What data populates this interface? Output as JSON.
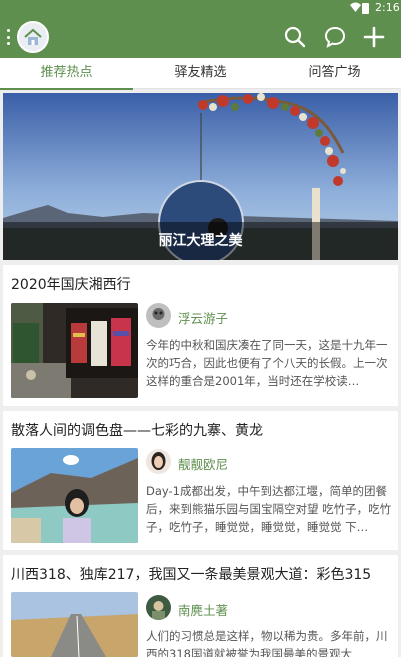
{
  "status_bar": {
    "time": "2:16"
  },
  "app": {
    "accent": "#5f8f4e"
  },
  "appbar": {
    "icons": [
      "menu-dots-icon",
      "app-logo-icon",
      "search-icon",
      "chat-bubble-icon",
      "plus-icon"
    ]
  },
  "tabs": [
    {
      "label": "推荐热点",
      "active": true
    },
    {
      "label": "驿友精选",
      "active": false
    },
    {
      "label": "问答广场",
      "active": false
    }
  ],
  "banner": {
    "caption": "丽江大理之美"
  },
  "posts": [
    {
      "title": "2020年国庆湘西行",
      "author": "浮云游子",
      "excerpt": "今年的中秋和国庆凑在了同一天，这是十九年一次的巧合，因此也便有了个八天的长假。上一次这样的重合是2001年，当时还在学校读…"
    },
    {
      "title": "散落人间的调色盘——七彩的九寨、黄龙",
      "author": "靓靓欧尼",
      "excerpt": "Day-1成都出发，中午到达都江堰，简单的团餐后，来到熊猫乐园与国宝隔空对望 吃竹子，吃竹子，吃竹子，睡觉觉，睡觉觉，睡觉觉 下…"
    },
    {
      "title": "川西318、独库217，我国又一条最美景观大道：彩色315",
      "author": "南麂土著",
      "excerpt": "人们的习惯总是这样，物以稀为贵。多年前，川西的318国道就被誉为我国最美的景观大"
    }
  ]
}
